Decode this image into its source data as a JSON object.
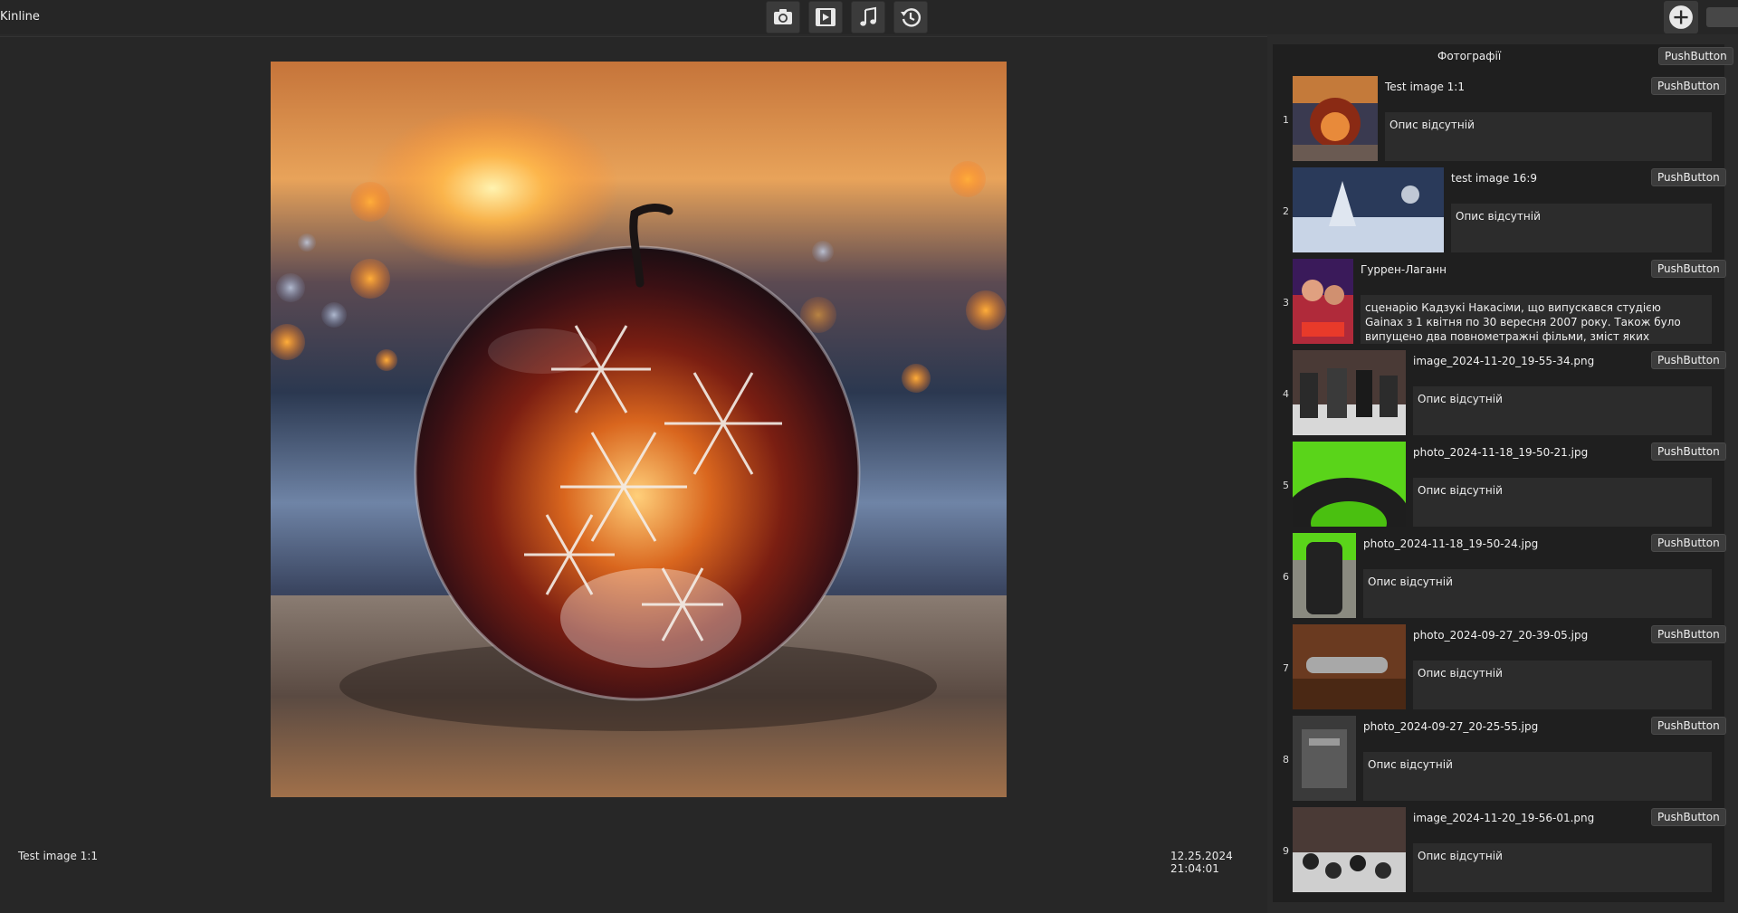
{
  "app": {
    "title": "Kinline"
  },
  "toolbar": {
    "icons": [
      "camera-icon",
      "video-icon",
      "music-note-icon",
      "history-icon"
    ],
    "add_icon": "plus-circle-icon"
  },
  "viewer": {
    "caption": "Test image 1:1",
    "datetime": "12.25.2024 21:04:01"
  },
  "sidebar": {
    "title": "Фотографії",
    "header_button": "PushButton",
    "items": [
      {
        "num": "1",
        "title": "Test image 1:1",
        "button": "PushButton",
        "description": "Опис відсутній"
      },
      {
        "num": "2",
        "title": "test image 16:9",
        "button": "PushButton",
        "description": "Опис відсутній"
      },
      {
        "num": "3",
        "title": "Гуррен-Лаганн",
        "button": "PushButton",
        "description": "сценарію Кадзукі Накасіми, що випускався студією Gainax з 1 квітня по 30 вересня 2007 року. Також було випущено два повнометражні фільми, зміст яких ідентичний змісту аніме-серіалу за винятком"
      },
      {
        "num": "4",
        "title": "image_2024-11-20_19-55-34.png",
        "button": "PushButton",
        "description": "Опис відсутній"
      },
      {
        "num": "5",
        "title": "photo_2024-11-18_19-50-21.jpg",
        "button": "PushButton",
        "description": "Опис відсутній"
      },
      {
        "num": "6",
        "title": "photo_2024-11-18_19-50-24.jpg",
        "button": "PushButton",
        "description": "Опис відсутній"
      },
      {
        "num": "7",
        "title": "photo_2024-09-27_20-39-05.jpg",
        "button": "PushButton",
        "description": "Опис відсутній"
      },
      {
        "num": "8",
        "title": "photo_2024-09-27_20-25-55.jpg",
        "button": "PushButton",
        "description": "Опис відсутній"
      },
      {
        "num": "9",
        "title": "image_2024-11-20_19-56-01.png",
        "button": "PushButton",
        "description": "Опис відсутній"
      }
    ]
  }
}
